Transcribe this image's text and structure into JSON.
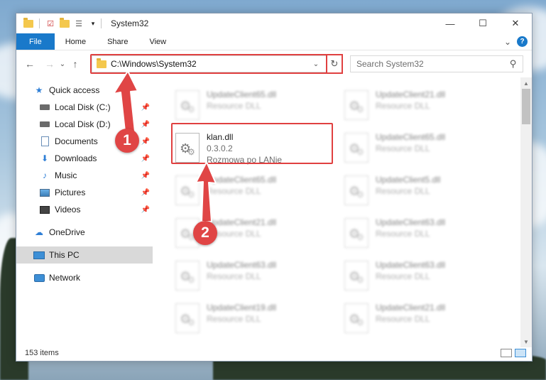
{
  "window": {
    "title": "System32",
    "controls": {
      "minimize": "—",
      "maximize": "☐",
      "close": "✕"
    }
  },
  "ribbon": {
    "tabs": [
      "File",
      "Home",
      "Share",
      "View"
    ],
    "expand": "⌄",
    "help": "?"
  },
  "navigation": {
    "back": "←",
    "forward": "→",
    "recent": "⌄",
    "up": "↑",
    "address": "C:\\Windows\\System32",
    "address_dropdown": "⌄",
    "refresh": "↻",
    "search_placeholder": "Search System32",
    "search_icon": "⚲"
  },
  "sidebar": {
    "items": [
      {
        "label": "Quick access",
        "icon": "star-icon",
        "pinned": false
      },
      {
        "label": "Local Disk (C:)",
        "icon": "disk-icon",
        "pinned": true
      },
      {
        "label": "Local Disk (D:)",
        "icon": "disk-icon",
        "pinned": true
      },
      {
        "label": "Documents",
        "icon": "documents-icon",
        "pinned": true
      },
      {
        "label": "Downloads",
        "icon": "downloads-icon",
        "pinned": true
      },
      {
        "label": "Music",
        "icon": "music-icon",
        "pinned": true
      },
      {
        "label": "Pictures",
        "icon": "pictures-icon",
        "pinned": true
      },
      {
        "label": "Videos",
        "icon": "videos-icon",
        "pinned": true
      },
      {
        "label": "OneDrive",
        "icon": "onedrive-icon",
        "pinned": false
      },
      {
        "label": "This PC",
        "icon": "this-pc-icon",
        "pinned": false,
        "selected": true
      },
      {
        "label": "Network",
        "icon": "network-icon",
        "pinned": false
      }
    ],
    "pin_glyph": "📌"
  },
  "files": [
    {
      "name": "UpdateClient65.dll",
      "line2": "Resource DLL",
      "line3": "",
      "blurred": true
    },
    {
      "name": "UpdateClient21.dll",
      "line2": "Resource DLL",
      "line3": "",
      "blurred": true
    },
    {
      "name": "klan.dll",
      "line2": "0.3.0.2",
      "line3": "Rozmowa po LANie",
      "blurred": false
    },
    {
      "name": "UpdateClient65.dll",
      "line2": "Resource DLL",
      "line3": "",
      "blurred": true
    },
    {
      "name": "UpdateClient65.dll",
      "line2": "Resource DLL",
      "line3": "",
      "blurred": true
    },
    {
      "name": "UpdateClient5.dll",
      "line2": "Resource DLL",
      "line3": "",
      "blurred": true
    },
    {
      "name": "UpdateClient21.dll",
      "line2": "Resource DLL",
      "line3": "",
      "blurred": true
    },
    {
      "name": "UpdateClient63.dll",
      "line2": "Resource DLL",
      "line3": "",
      "blurred": true
    },
    {
      "name": "UpdateClient63.dll",
      "line2": "Resource DLL",
      "line3": "",
      "blurred": true
    },
    {
      "name": "UpdateClient63.dll",
      "line2": "Resource DLL",
      "line3": "",
      "blurred": true
    },
    {
      "name": "UpdateClient19.dll",
      "line2": "Resource DLL",
      "line3": "",
      "blurred": true
    },
    {
      "name": "UpdateClient21.dll",
      "line2": "Resource DLL",
      "line3": "",
      "blurred": true
    }
  ],
  "status": {
    "item_count": "153 items"
  },
  "callouts": [
    "1",
    "2"
  ],
  "colors": {
    "accent": "#1979ca",
    "annotation_red": "#e04040",
    "selected_nav": "#d9d9d9"
  }
}
